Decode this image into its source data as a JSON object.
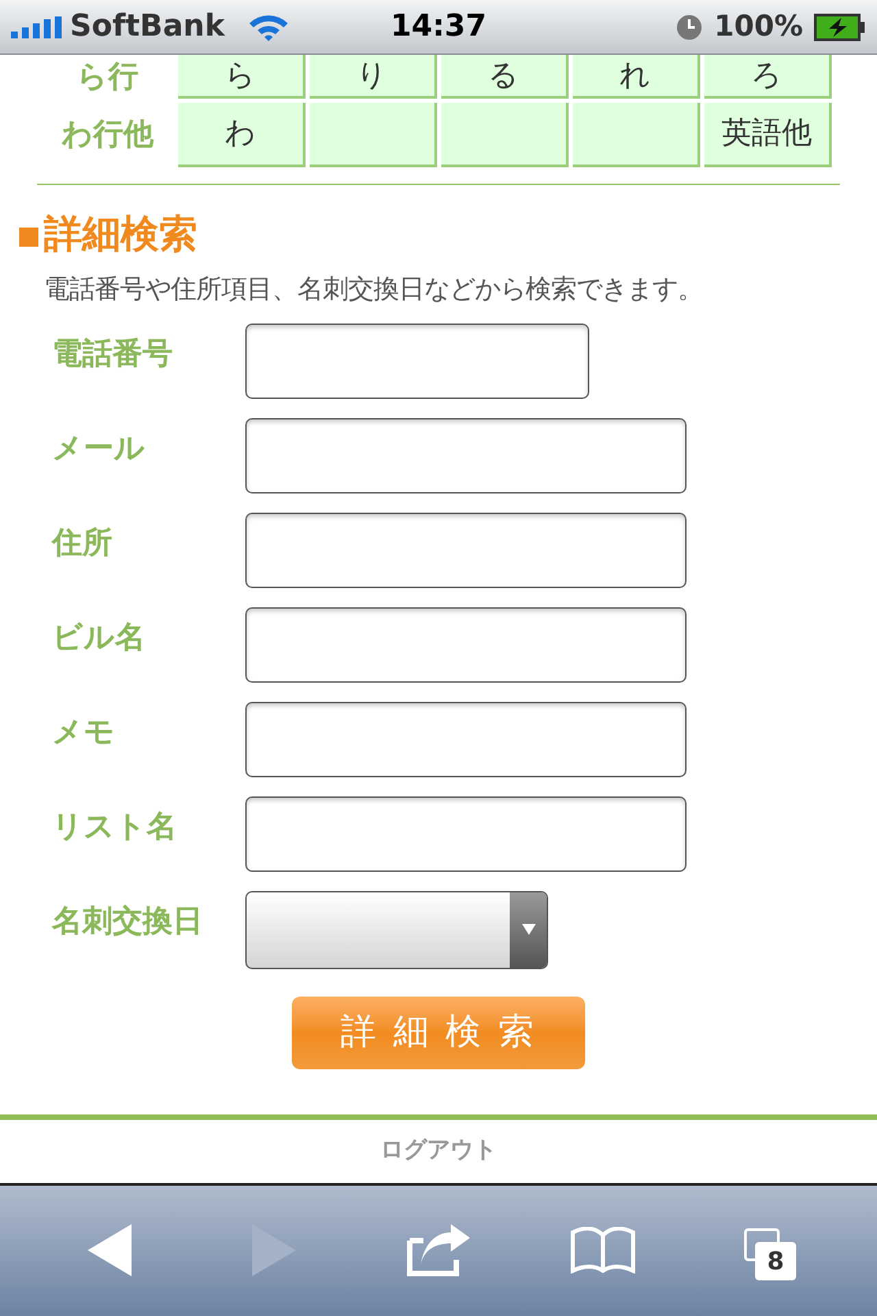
{
  "status_bar": {
    "carrier": "SoftBank",
    "time": "14:37",
    "battery": "100%"
  },
  "kana_table": {
    "rows": [
      {
        "label": "ら行",
        "cells": [
          "ら",
          "り",
          "る",
          "れ",
          "ろ"
        ]
      },
      {
        "label": "わ行他",
        "cells": [
          "わ",
          "",
          "",
          "",
          "英語他"
        ]
      }
    ]
  },
  "detail_search": {
    "heading": "詳細検索",
    "description": "電話番号や住所項目、名刺交換日などから検索できます。",
    "fields": [
      {
        "label": "電話番号",
        "kind": "short"
      },
      {
        "label": "メール",
        "kind": "text"
      },
      {
        "label": "住所",
        "kind": "text"
      },
      {
        "label": "ビル名",
        "kind": "text"
      },
      {
        "label": "メモ",
        "kind": "text"
      },
      {
        "label": "リスト名",
        "kind": "text"
      },
      {
        "label": "名刺交換日",
        "kind": "select"
      }
    ],
    "button": "詳 細 検 索"
  },
  "footer": {
    "logout": "ログアウト"
  },
  "toolbar": {
    "items": [
      {
        "kind": "back",
        "disabled": false
      },
      {
        "kind": "forward",
        "disabled": true
      },
      {
        "kind": "share",
        "disabled": false
      },
      {
        "kind": "bookmarks",
        "disabled": false
      },
      {
        "kind": "tabs",
        "disabled": false,
        "count": "8"
      }
    ]
  }
}
